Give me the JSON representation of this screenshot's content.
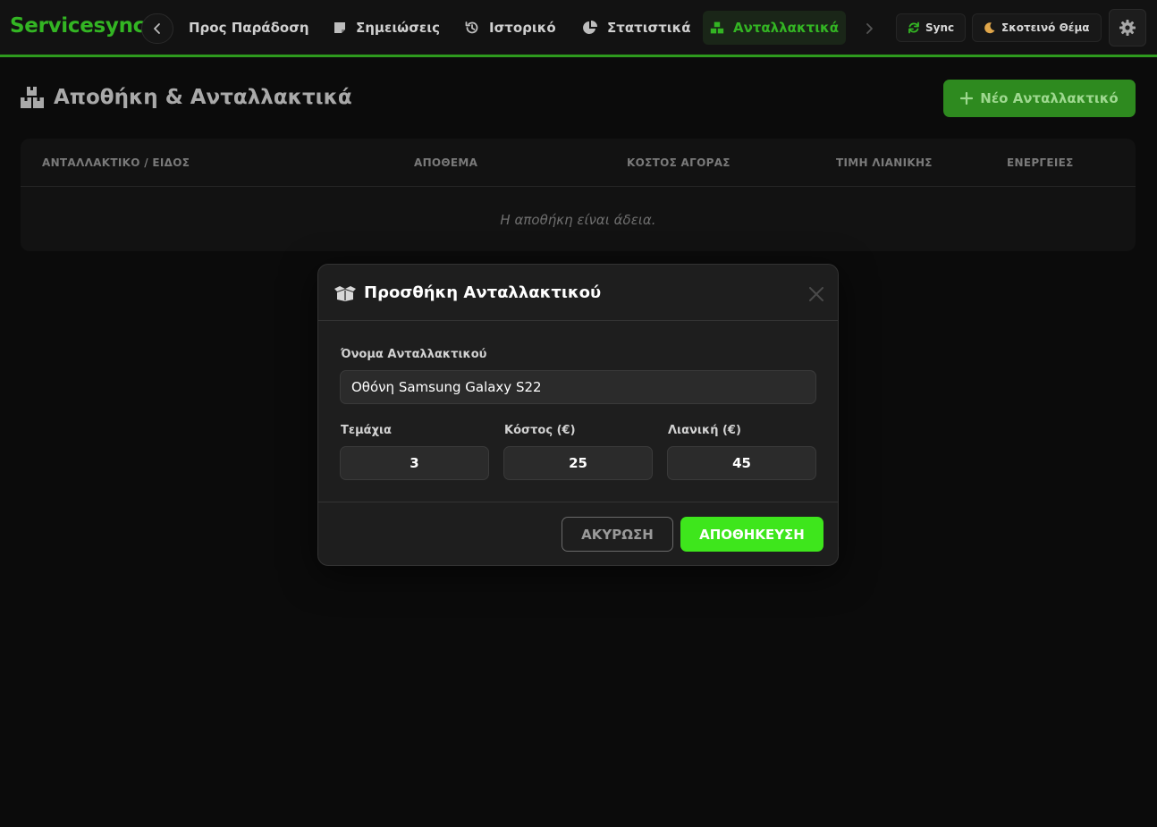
{
  "app": {
    "brand": "Servicesync"
  },
  "nav": {
    "items": [
      {
        "label": "Προς Παράδοση",
        "icon": "none"
      },
      {
        "label": "Σημειώσεις",
        "icon": "note-icon"
      },
      {
        "label": "Ιστορικό",
        "icon": "history-icon"
      },
      {
        "label": "Στατιστικά",
        "icon": "pie-chart-icon"
      },
      {
        "label": "Ανταλλακτικά",
        "icon": "boxes-icon",
        "active": true
      }
    ],
    "sync_label": "Sync",
    "theme_label": "Σκοτεινό Θέμα"
  },
  "page": {
    "title": "Αποθήκη & Ανταλλακτικά",
    "new_button_label": "Νέο Ανταλλακτικό"
  },
  "table": {
    "columns": [
      "ΑΝΤΑΛΛΑΚΤΙΚΟ / ΕΙΔΟΣ",
      "ΑΠΟΘΕΜΑ",
      "ΚΟΣΤΟΣ ΑΓΟΡΑΣ",
      "ΤΙΜΗ ΛΙΑΝΙΚΗΣ",
      "ΕΝΕΡΓΕΙΕΣ"
    ],
    "empty_text": "Η αποθήκη είναι άδεια."
  },
  "modal": {
    "title": "Προσθήκη Ανταλλακτικού",
    "name_label": "Όνομα Ανταλλακτικού",
    "name_value": "Οθόνη Samsung Galaxy S22",
    "qty_label": "Τεμάχια",
    "qty_value": "3",
    "cost_label": "Κόστος (€)",
    "cost_value": "25",
    "retail_label": "Λιανική (€)",
    "retail_value": "45",
    "cancel_label": "ΑΚΥΡΩΣΗ",
    "save_label": "ΑΠΟΘΗΚΕΥΣΗ"
  },
  "colors": {
    "accent": "#33b523",
    "save_button": "#3ee61c",
    "background": "#0b0b0b"
  }
}
